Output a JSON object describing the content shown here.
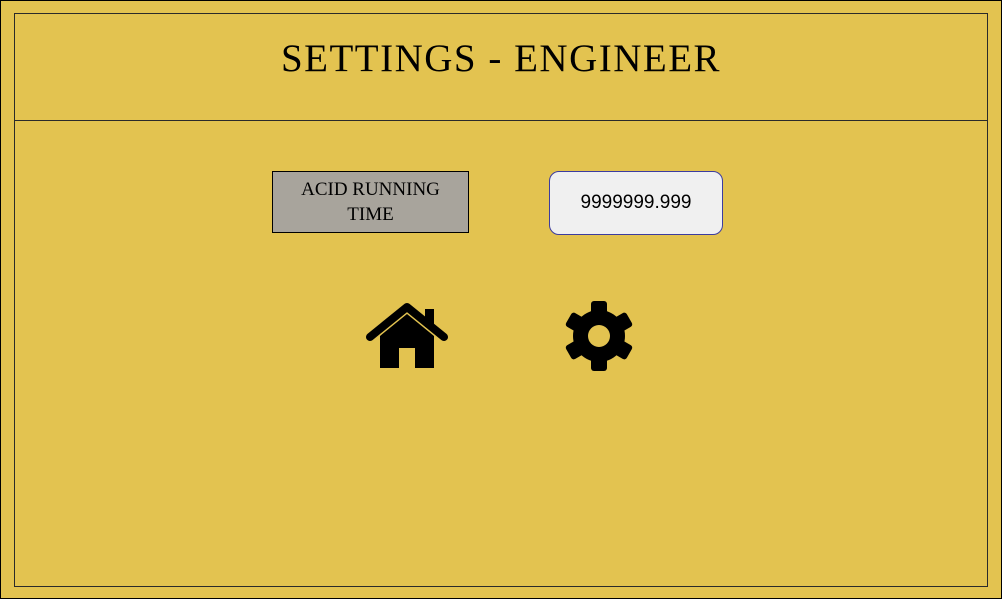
{
  "header": {
    "title": "SETTINGS - ENGINEER"
  },
  "parameter": {
    "label_line1": "ACID RUNNING",
    "label_line2": "TIME",
    "value": "9999999.999"
  },
  "navigation": {
    "home_icon": "home-icon",
    "settings_icon": "gear-icon"
  },
  "colors": {
    "background": "#E3C350",
    "label_background": "#A8A49C",
    "input_background": "#F0F0F0",
    "input_border": "#3C3CA0",
    "icon": "#000000"
  }
}
